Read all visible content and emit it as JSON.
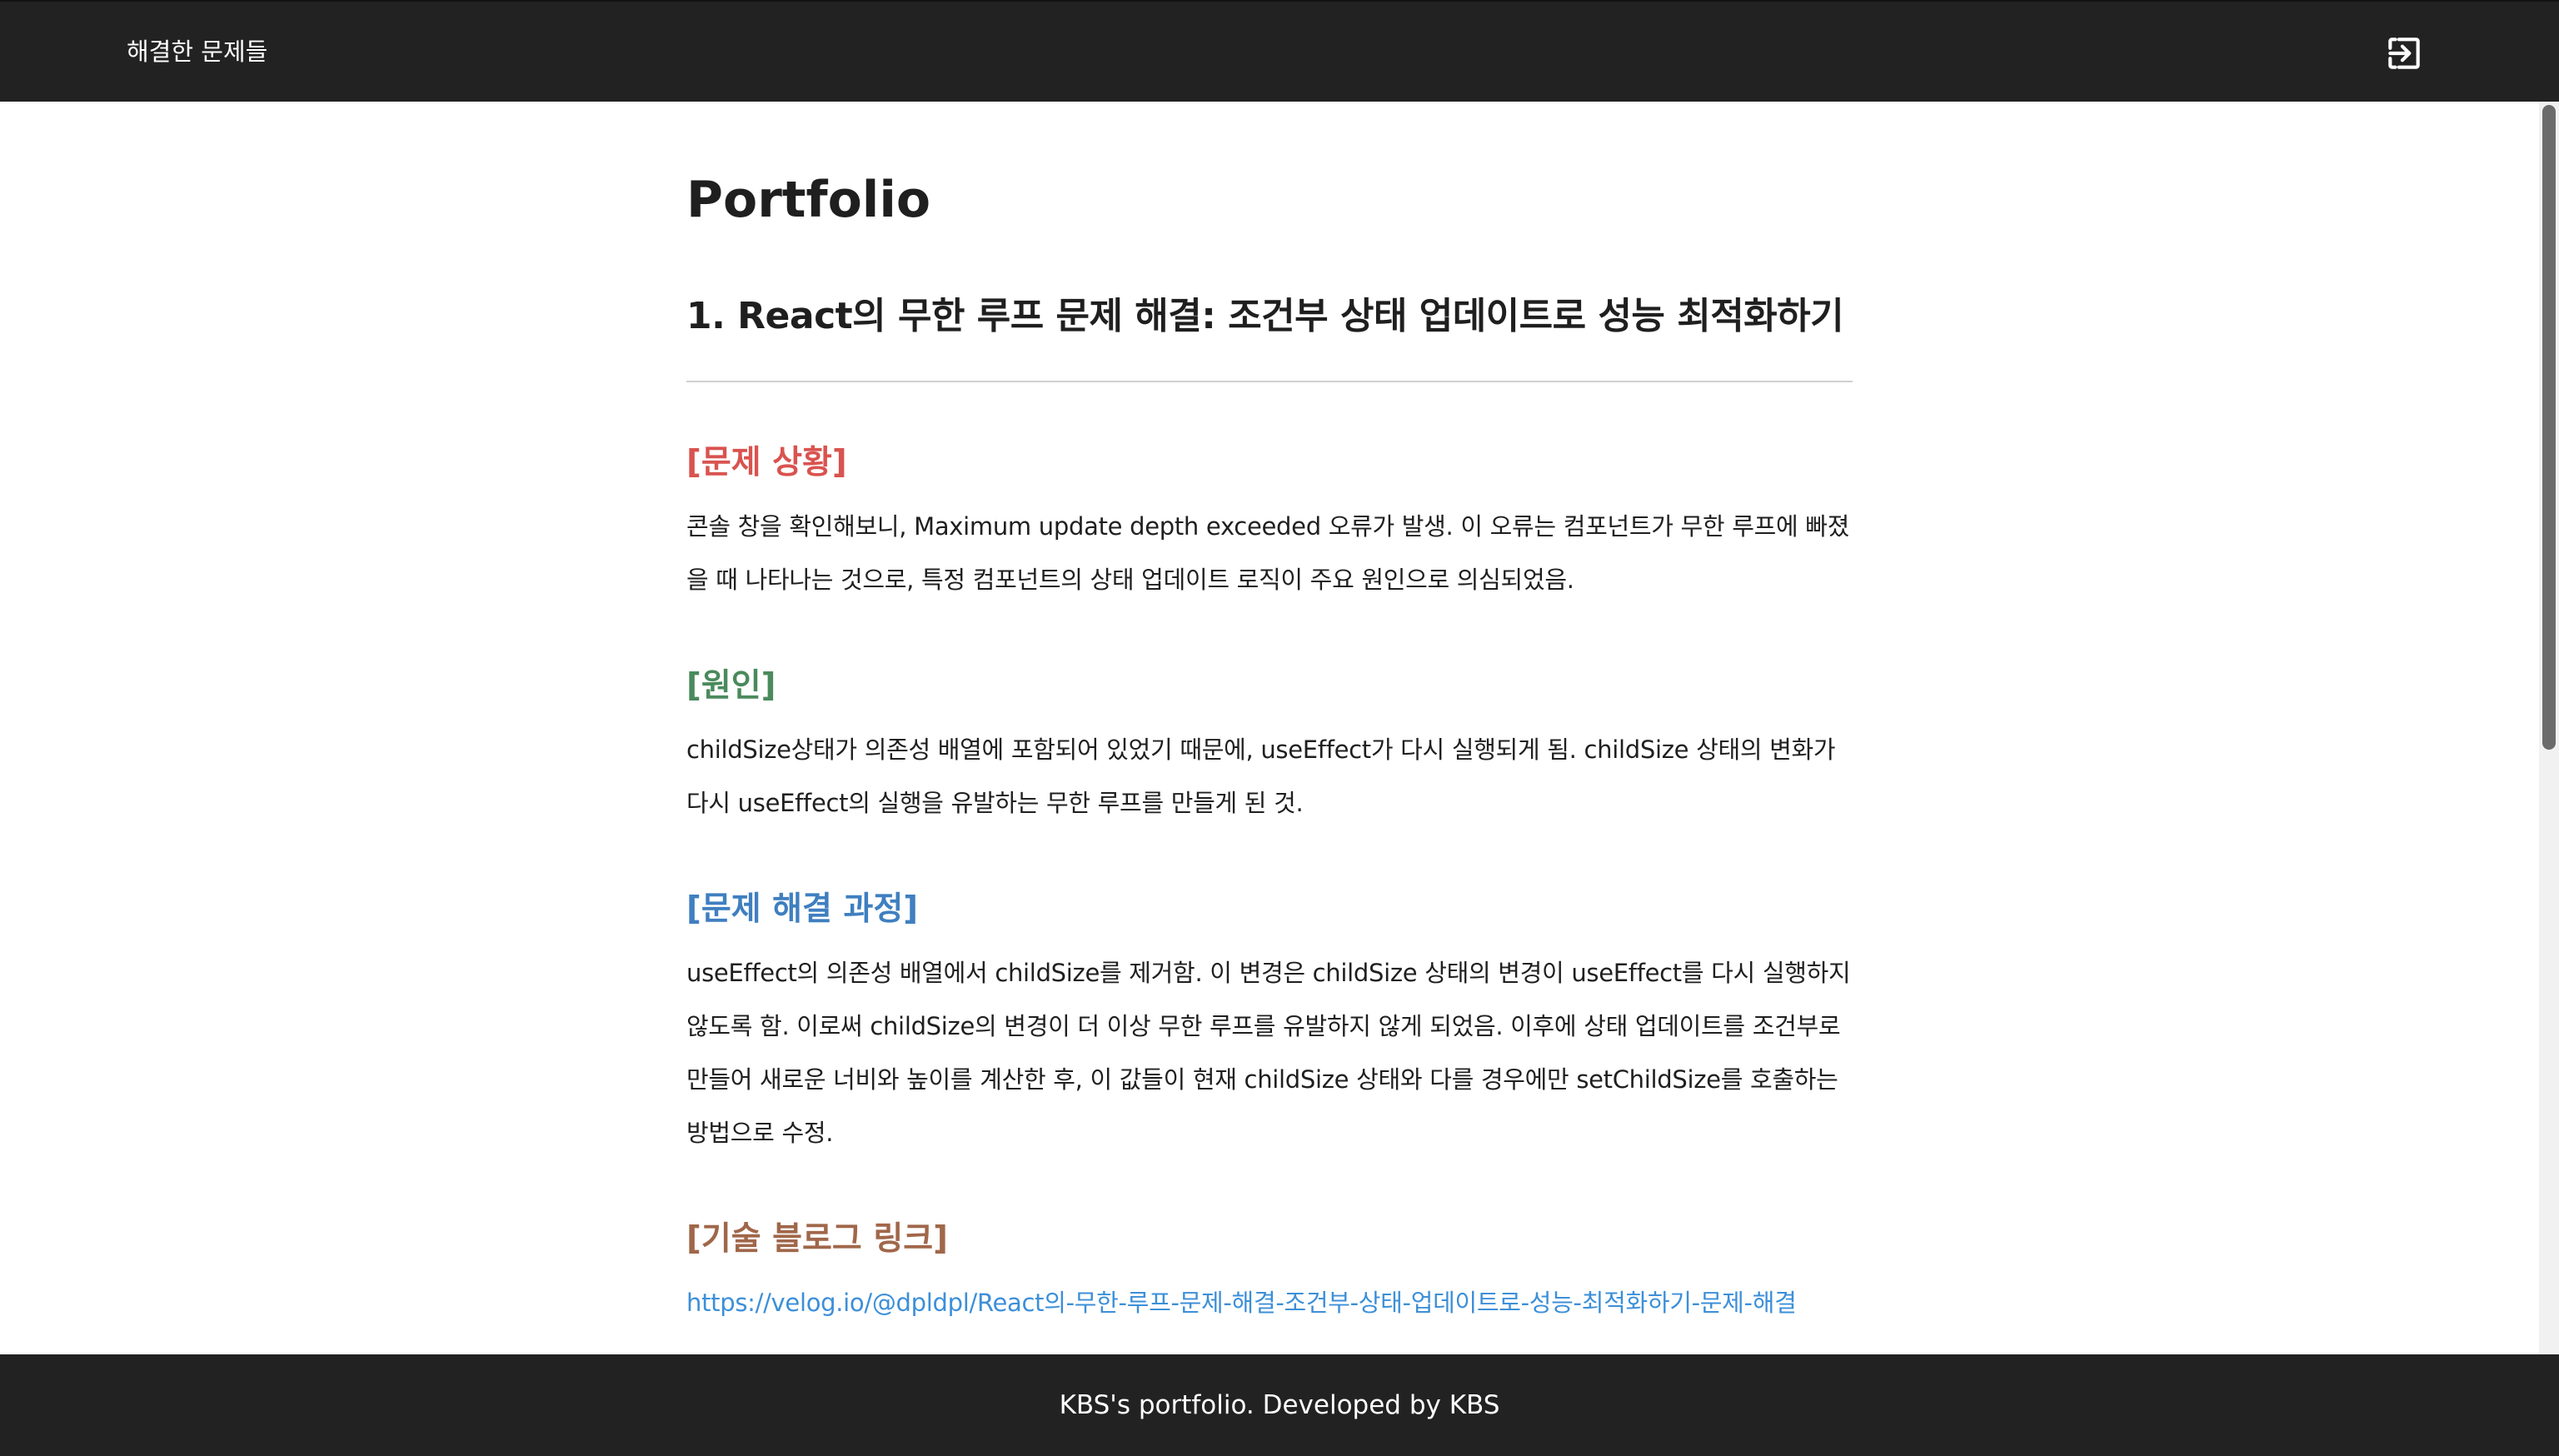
{
  "header": {
    "title": "해결한 문제들",
    "logout_icon": "logout-icon"
  },
  "page": {
    "title": "Portfolio"
  },
  "post": {
    "title": "1. React의 무한 루프 문제 해결: 조건부 상태 업데이트로 성능 최적화하기",
    "sections": [
      {
        "heading": "[문제 상황]",
        "color": "#d9534f",
        "body": "콘솔 창을 확인해보니, Maximum update depth exceeded 오류가 발생. 이 오류는 컴포넌트가 무한 루프에 빠졌을 때 나타나는 것으로, 특정 컴포넌트의 상태 업데이트 로직이 주요 원인으로 의심되었음."
      },
      {
        "heading": "[원인]",
        "color": "#4a8a5c",
        "body": "childSize상태가 의존성 배열에 포함되어 있었기 때문에, useEffect가 다시 실행되게 됨. childSize 상태의 변화가 다시 useEffect의 실행을 유발하는 무한 루프를 만들게 된 것."
      },
      {
        "heading": "[문제 해결 과정]",
        "color": "#3f7fc0",
        "body": "useEffect의 의존성 배열에서 childSize를 제거함. 이 변경은 childSize 상태의 변경이 useEffect를 다시 실행하지 않도록 함. 이로써 childSize의 변경이 더 이상 무한 루프를 유발하지 않게 되었음. 이후에 상태 업데이트를 조건부로 만들어 새로운 너비와 높이를 계산한 후, 이 값들이 현재 childSize 상태와 다를 경우에만 setChildSize를 호출하는 방법으로 수정."
      },
      {
        "heading": "[기술 블로그 링크]",
        "color": "#a0674a",
        "link": "https://velog.io/@dpldpl/React의-무한-루프-문제-해결-조건부-상태-업데이트로-성능-최적화하기-문제-해결"
      }
    ]
  },
  "colors": {
    "link": "#3c8fd8",
    "bar": "#222222"
  },
  "footer": {
    "text": "KBS's portfolio. Developed by KBS"
  }
}
